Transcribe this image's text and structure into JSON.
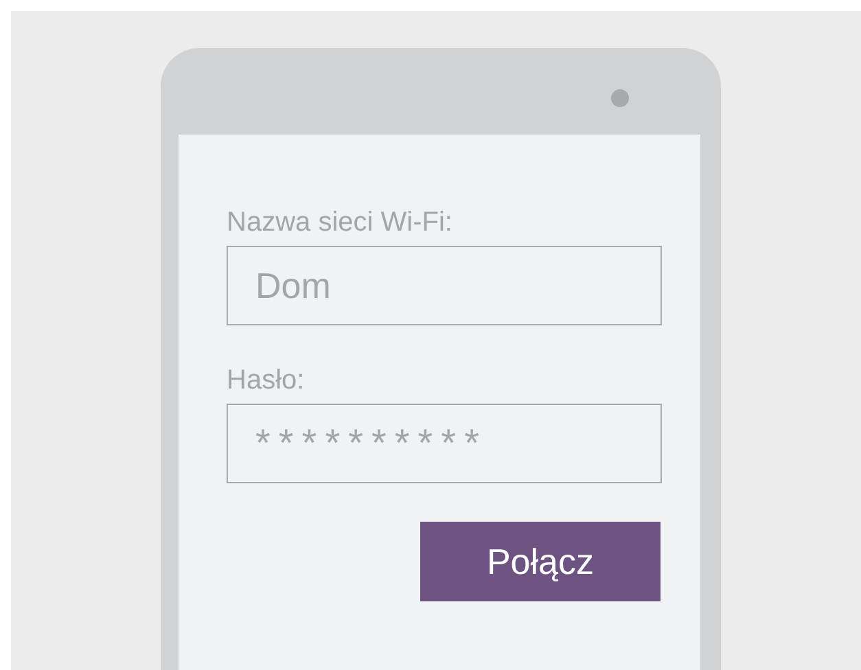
{
  "form": {
    "fields": [
      {
        "label": "Nazwa sieci Wi-Fi:",
        "value": "Dom"
      },
      {
        "label": "Hasło:",
        "value": "**********"
      }
    ],
    "button": "Połącz"
  }
}
